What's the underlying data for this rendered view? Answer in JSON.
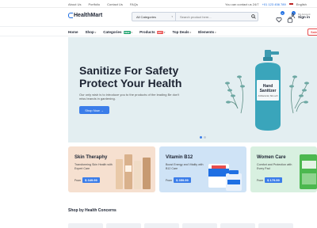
{
  "topbar": {
    "links": [
      "About Us",
      "Portfolio",
      "Contact Us",
      "FAQs"
    ],
    "contact_prefix": "You can contact us 24/7",
    "phone": "+01 123 456 789",
    "language": "English"
  },
  "header": {
    "logo": "HealthMart",
    "search_category": "All Categories",
    "search_placeholder": "Search product here...",
    "wishlist_count": "0",
    "cart_count": "0",
    "account_caption": "My Account",
    "account_action": "Sign in"
  },
  "nav": {
    "items": [
      {
        "label": "Home"
      },
      {
        "label": "Shop"
      },
      {
        "label": "Categories",
        "tag": "NEW"
      },
      {
        "label": "Products",
        "tag": "HOT"
      },
      {
        "label": "Top Deals"
      },
      {
        "label": "Elements"
      }
    ],
    "sale_label": "Sale"
  },
  "hero": {
    "title": "Sanitize For Safety Protect Your Health",
    "description": "Our only wish is to introduce you to the products of the leading Be don't miss brands in gardening.",
    "button": "Shop Now",
    "bottle_label_1": "Hand",
    "bottle_label_2": "Sanitizer",
    "bottle_label_3": "Antibacterial, Skin-soft",
    "slide_count": 2,
    "active_slide": 1
  },
  "promos": [
    {
      "title": "Skin Theraphy",
      "subtitle": "Transforming Skin Health with Expert Care",
      "from": "From",
      "price": "$ 349.99"
    },
    {
      "title": "Vitamin B12",
      "subtitle": "Boost Energy and Vitality with B12 Care",
      "from": "From",
      "price": "$ 359.99"
    },
    {
      "title": "Women Care",
      "subtitle": "Comfort and Protection with Every Pad",
      "from": "From",
      "price": "$ 179.99"
    }
  ],
  "section": {
    "title": "Shop by Health Concerns"
  },
  "colors": {
    "accent": "#3b7de9",
    "navy": "#1d2433",
    "hero_bg": "#e3eef1"
  },
  "icons": [
    "search-icon",
    "heart-icon",
    "bag-icon",
    "user-icon",
    "flag-icon"
  ]
}
